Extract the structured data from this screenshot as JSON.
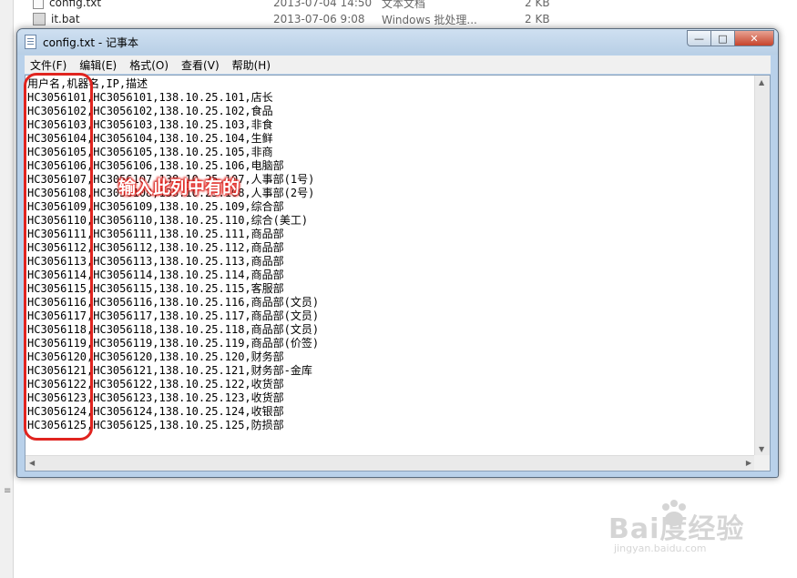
{
  "background_explorer": {
    "files": [
      {
        "name": "config.txt",
        "date": "2013-07-04 14:50",
        "type": "文本文档",
        "size": "2 KB"
      },
      {
        "name": "it.bat",
        "date": "2013-07-06 9:08",
        "type": "Windows 批处理...",
        "size": "2 KB"
      }
    ]
  },
  "window": {
    "title": "config.txt - 记事本",
    "menu": [
      "文件(F)",
      "编辑(E)",
      "格式(O)",
      "查看(V)",
      "帮助(H)"
    ],
    "controls": {
      "minimize": "—",
      "maximize": "□",
      "close": "✕"
    }
  },
  "content": {
    "lines": [
      "用户名,机器名,IP,描述",
      "HC3056101,HC3056101,138.10.25.101,店长",
      "HC3056102,HC3056102,138.10.25.102,食品",
      "HC3056103,HC3056103,138.10.25.103,非食",
      "HC3056104,HC3056104,138.10.25.104,生鲜",
      "HC3056105,HC3056105,138.10.25.105,非商",
      "HC3056106,HC3056106,138.10.25.106,电脑部",
      "HC3056107,HC3056107,138.10.25.107,人事部(1号)",
      "HC3056108,HC3056108,138.10.25.108,人事部(2号)",
      "HC3056109,HC3056109,138.10.25.109,综合部",
      "HC3056110,HC3056110,138.10.25.110,综合(美工)",
      "HC3056111,HC3056111,138.10.25.111,商品部",
      "HC3056112,HC3056112,138.10.25.112,商品部",
      "HC3056113,HC3056113,138.10.25.113,商品部",
      "HC3056114,HC3056114,138.10.25.114,商品部",
      "HC3056115,HC3056115,138.10.25.115,客服部",
      "HC3056116,HC3056116,138.10.25.116,商品部(文员)",
      "HC3056117,HC3056117,138.10.25.117,商品部(文员)",
      "HC3056118,HC3056118,138.10.25.118,商品部(文员)",
      "HC3056119,HC3056119,138.10.25.119,商品部(价签)",
      "HC3056120,HC3056120,138.10.25.120,财务部",
      "HC3056121,HC3056121,138.10.25.121,财务部-金库",
      "HC3056122,HC3056122,138.10.25.122,收货部",
      "HC3056123,HC3056123,138.10.25.123,收货部",
      "HC3056124,HC3056124,138.10.25.124,收银部",
      "HC3056125,HC3056125,138.10.25.125,防损部"
    ]
  },
  "annotation": {
    "text": "输入此列中有的",
    "color": "#e0241f"
  },
  "watermark": {
    "main": "Bai度经验",
    "sub": "jingyan.baidu.com"
  }
}
